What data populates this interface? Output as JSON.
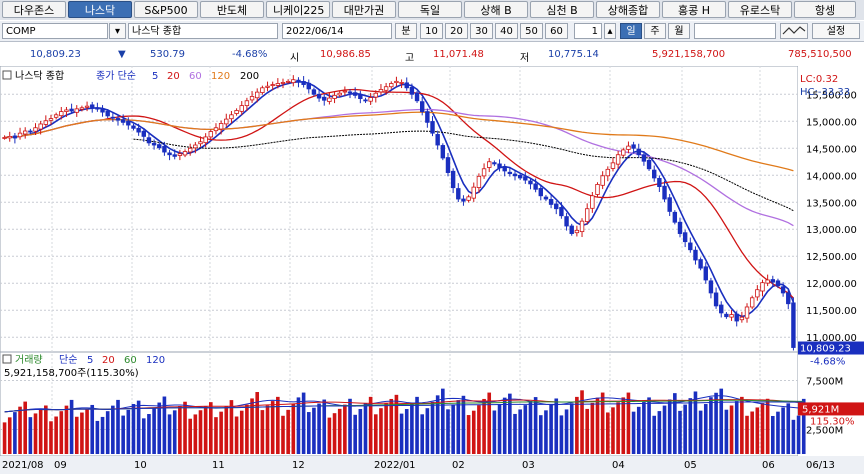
{
  "tabs": [
    {
      "label": "다우존스",
      "active": false
    },
    {
      "label": "나스닥",
      "active": true
    },
    {
      "label": "S&P500",
      "active": false
    },
    {
      "label": "반도체",
      "active": false
    },
    {
      "label": "니케이225",
      "active": false
    },
    {
      "label": "대만가권",
      "active": false
    },
    {
      "label": "독일",
      "active": false
    },
    {
      "label": "상해 B",
      "active": false
    },
    {
      "label": "심천 B",
      "active": false
    },
    {
      "label": "상해종합",
      "active": false
    },
    {
      "label": "홍콩 H",
      "active": false
    },
    {
      "label": "유로스탁",
      "active": false
    },
    {
      "label": "항셍",
      "active": false
    }
  ],
  "toolbar": {
    "symbol": "COMP",
    "name": "나스닥 종합",
    "date": "2022/06/14",
    "period_unit": "분",
    "minute_options": [
      "10",
      "20",
      "30",
      "40",
      "50",
      "60"
    ],
    "count": "1",
    "periods": [
      "일",
      "주",
      "월"
    ],
    "selected_period": "일",
    "settings_label": "설정"
  },
  "quote": {
    "last": "10,809.23",
    "change_arrow": "▼",
    "change": "530.79",
    "change_pct": "-4.68%",
    "open_label": "시",
    "open": "10,986.85",
    "high_label": "고",
    "high": "11,071.48",
    "low_label": "저",
    "low": "10,775.14",
    "volume": "5,921,158,700",
    "amount": "785,510,500"
  },
  "price_panel": {
    "name": "나스닥 종합",
    "ma_label": "종가 단순",
    "ma_periods": [
      "5",
      "20",
      "60",
      "120",
      "200"
    ],
    "ma_colors": [
      "#1a2fbf",
      "#d01414",
      "#b070e0",
      "#e07a1a",
      "#000000"
    ],
    "lc": "LC:0.32",
    "hc": "HC:-33.33",
    "y_ticks": [
      "15,500.00",
      "15,000.00",
      "14,500.00",
      "14,000.00",
      "13,500.00",
      "13,000.00",
      "12,500.00",
      "12,000.00",
      "11,500.00",
      "11,000.00"
    ],
    "last_price": "10,809.23",
    "last_pct": "-4.68%"
  },
  "volume_panel": {
    "title": "거래량",
    "ma_label": "단순",
    "ma_periods": [
      "5",
      "20",
      "60",
      "120"
    ],
    "ma_colors": [
      "#1a2fbf",
      "#d01414",
      "#2e8b2e",
      "#1a2fbf"
    ],
    "value": "5,921,158,700주(115.30%)",
    "y_ticks": [
      "7,500M",
      "2,500M"
    ],
    "last_volume": "5,921M",
    "last_pct": "115.30%"
  },
  "x_axis": [
    "2021/08",
    "09",
    "10",
    "11",
    "12",
    "2022/01",
    "02",
    "03",
    "04",
    "05",
    "06",
    "06/13"
  ],
  "chart_data": {
    "type": "candlestick",
    "title": "나스닥 종합",
    "y_range": [
      10800,
      15950
    ],
    "closes": [
      14700,
      14720,
      14690,
      14780,
      14820,
      14800,
      14880,
      14950,
      15010,
      15050,
      15120,
      15180,
      15210,
      15190,
      15230,
      15250,
      15280,
      15260,
      15230,
      15170,
      15100,
      15060,
      15020,
      14980,
      14930,
      14870,
      14800,
      14720,
      14600,
      14560,
      14510,
      14430,
      14380,
      14350,
      14400,
      14440,
      14500,
      14560,
      14620,
      14710,
      14810,
      14880,
      14960,
      15040,
      15120,
      15200,
      15290,
      15380,
      15460,
      15540,
      15620,
      15650,
      15680,
      15700,
      15720,
      15740,
      15770,
      15730,
      15680,
      15600,
      15500,
      15430,
      15390,
      15430,
      15480,
      15520,
      15560,
      15530,
      15480,
      15420,
      15380,
      15440,
      15520,
      15590,
      15640,
      15700,
      15740,
      15720,
      15620,
      15500,
      15380,
      15180,
      14980,
      14780,
      14560,
      14320,
      14050,
      13770,
      13560,
      13520,
      13600,
      13780,
      13980,
      14120,
      14250,
      14210,
      14140,
      14080,
      14030,
      13990,
      13950,
      13910,
      13840,
      13740,
      13620,
      13560,
      13460,
      13380,
      13250,
      13060,
      12920,
      12980,
      13150,
      13380,
      13620,
      13830,
      13990,
      14110,
      14230,
      14380,
      14470,
      14540,
      14500,
      14380,
      14260,
      14120,
      13950,
      13790,
      13560,
      13330,
      13130,
      12920,
      12770,
      12620,
      12430,
      12280,
      12060,
      11820,
      11580,
      11450,
      11380,
      11420,
      11300,
      11370,
      11560,
      11730,
      11880,
      12010,
      12060,
      12020,
      11950,
      11820,
      11620,
      10809
    ],
    "volume_range": [
      0,
      10000
    ],
    "volumes": [
      4300,
      4400,
      4500,
      4600,
      4650,
      4700,
      4600,
      4550,
      4500,
      4450,
      4500,
      4600,
      4700,
      4800,
      4750,
      4700,
      4600,
      4550,
      4500,
      4450,
      4600,
      4700,
      4800,
      4900,
      5000,
      5100,
      4950,
      4850,
      4800,
      4900,
      5000,
      5100,
      5050,
      4950,
      4900,
      4850,
      4800,
      4750,
      4700,
      4650,
      4600,
      4700,
      4800,
      4900,
      5000,
      5100,
      5200,
      5300,
      5400,
      5500,
      5600,
      5500,
      5400,
      5300,
      5200,
      5300,
      5400,
      5500,
      5450,
      5350,
      5250,
      5150,
      5050,
      4950,
      4900,
      4850,
      4800,
      4900,
      5000,
      5100,
      5200,
      5300,
      5400,
      5500,
      5450,
      5350,
      5250,
      5150,
      5100,
      5200,
      5300,
      5400,
      5500,
      5600,
      5700,
      5800,
      5700,
      5600,
      5500,
      5400,
      5300,
      5200,
      5250,
      5350,
      5450,
      5550,
      5650,
      5750,
      5600,
      5450,
      5350,
      5250,
      5150,
      5050,
      4950,
      4950,
      5050,
      5150,
      5250,
      5350,
      5450,
      5550,
      5650,
      5750,
      5800,
      5750,
      5700,
      5650,
      5600,
      5550,
      5500,
      5450,
      5400,
      5350,
      5300,
      5250,
      5200,
      5150,
      5200,
      5300,
      5400,
      5500,
      5600,
      5700,
      5800,
      5900,
      6000,
      6100,
      5950,
      5800,
      5650,
      5500,
      5400,
      5300,
      5200,
      5100,
      5000,
      4950,
      4900,
      4850,
      4800,
      4750,
      4700,
      4650,
      4600,
      5921
    ]
  }
}
